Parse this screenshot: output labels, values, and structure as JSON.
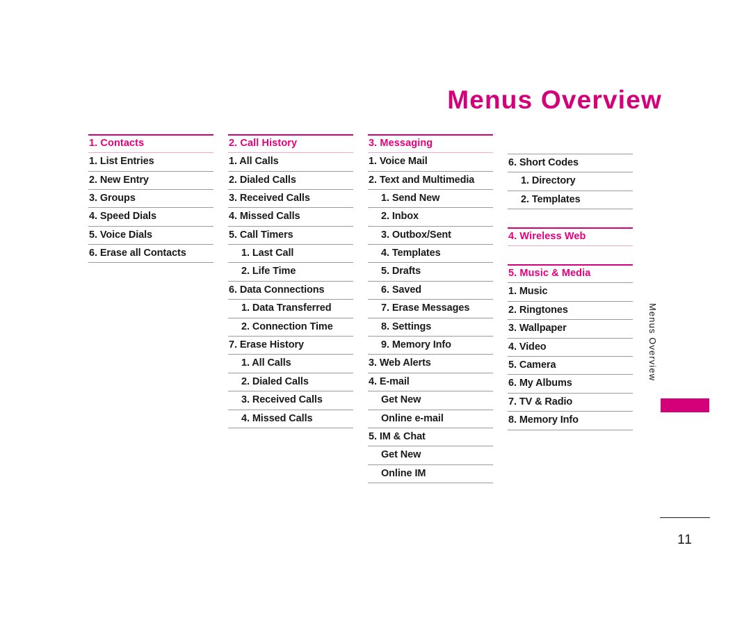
{
  "document": {
    "title": "Menus Overview",
    "side_label": "Menus Overview",
    "page_number": "11"
  },
  "colors": {
    "accent": "#d4007a",
    "accent_text": "#e5007e",
    "accent_rule_light": "#f0a6cd",
    "rule_grey": "#9a9a9a",
    "body_text": "#1a1a1a"
  },
  "columns": [
    {
      "name": "column-1",
      "offset": false,
      "sections": [
        {
          "header": "1. Contacts",
          "header_underline": "pink",
          "gap_before": false,
          "top_rule": false,
          "items": [
            {
              "label": "1. List Entries",
              "level": 1
            },
            {
              "label": "2. New Entry",
              "level": 1
            },
            {
              "label": "3. Groups",
              "level": 1
            },
            {
              "label": "4. Speed Dials",
              "level": 1
            },
            {
              "label": "5. Voice Dials",
              "level": 1
            },
            {
              "label": "6. Erase all Contacts",
              "level": 1
            }
          ]
        }
      ]
    },
    {
      "name": "column-2",
      "offset": false,
      "sections": [
        {
          "header": "2. Call History",
          "header_underline": "pink",
          "gap_before": false,
          "top_rule": false,
          "items": [
            {
              "label": "1. All Calls",
              "level": 1
            },
            {
              "label": "2. Dialed Calls",
              "level": 1
            },
            {
              "label": "3. Received Calls",
              "level": 1
            },
            {
              "label": "4. Missed Calls",
              "level": 1
            },
            {
              "label": "5. Call Timers",
              "level": 1
            },
            {
              "label": "1. Last Call",
              "level": 2
            },
            {
              "label": "2. Life Time",
              "level": 2
            },
            {
              "label": "6. Data Connections",
              "level": 1
            },
            {
              "label": "1. Data Transferred",
              "level": 2
            },
            {
              "label": "2. Connection Time",
              "level": 2
            },
            {
              "label": "7. Erase History",
              "level": 1
            },
            {
              "label": "1. All Calls",
              "level": 2
            },
            {
              "label": "2. Dialed Calls",
              "level": 2
            },
            {
              "label": "3. Received Calls",
              "level": 2
            },
            {
              "label": "4. Missed Calls",
              "level": 2
            }
          ]
        }
      ]
    },
    {
      "name": "column-3",
      "offset": false,
      "sections": [
        {
          "header": "3. Messaging",
          "header_underline": "pink",
          "gap_before": false,
          "top_rule": false,
          "items": [
            {
              "label": "1. Voice Mail",
              "level": 1
            },
            {
              "label": "2. Text and Multimedia",
              "level": 1
            },
            {
              "label": "1. Send New",
              "level": 2
            },
            {
              "label": "2. Inbox",
              "level": 2
            },
            {
              "label": "3. Outbox/Sent",
              "level": 2
            },
            {
              "label": "4. Templates",
              "level": 2
            },
            {
              "label": "5. Drafts",
              "level": 2
            },
            {
              "label": "6. Saved",
              "level": 2
            },
            {
              "label": "7. Erase Messages",
              "level": 2
            },
            {
              "label": "8. Settings",
              "level": 2
            },
            {
              "label": "9. Memory Info",
              "level": 2
            },
            {
              "label": "3. Web Alerts",
              "level": 1
            },
            {
              "label": "4. E-mail",
              "level": 1
            },
            {
              "label": "Get New",
              "level": 2
            },
            {
              "label": "Online e-mail",
              "level": 2
            },
            {
              "label": "5. IM & Chat",
              "level": 1
            },
            {
              "label": "Get New",
              "level": 2
            },
            {
              "label": "Online IM",
              "level": 2
            }
          ]
        }
      ]
    },
    {
      "name": "column-4",
      "offset": true,
      "sections": [
        {
          "header": null,
          "header_underline": null,
          "gap_before": false,
          "top_rule": true,
          "items": [
            {
              "label": "6. Short Codes",
              "level": 1
            },
            {
              "label": "1. Directory",
              "level": 2
            },
            {
              "label": "2. Templates",
              "level": 2
            }
          ]
        },
        {
          "header": "4. Wireless Web",
          "header_underline": "pink",
          "gap_before": true,
          "top_rule": false,
          "items": []
        },
        {
          "header": "5. Music & Media",
          "header_underline": "grey",
          "gap_before": true,
          "top_rule": false,
          "items": [
            {
              "label": "1. Music",
              "level": 1
            },
            {
              "label": "2. Ringtones",
              "level": 1
            },
            {
              "label": "3. Wallpaper",
              "level": 1
            },
            {
              "label": "4. Video",
              "level": 1
            },
            {
              "label": "5. Camera",
              "level": 1
            },
            {
              "label": "6. My Albums",
              "level": 1
            },
            {
              "label": "7. TV & Radio",
              "level": 1
            },
            {
              "label": "8. Memory Info",
              "level": 1
            }
          ]
        }
      ]
    }
  ]
}
